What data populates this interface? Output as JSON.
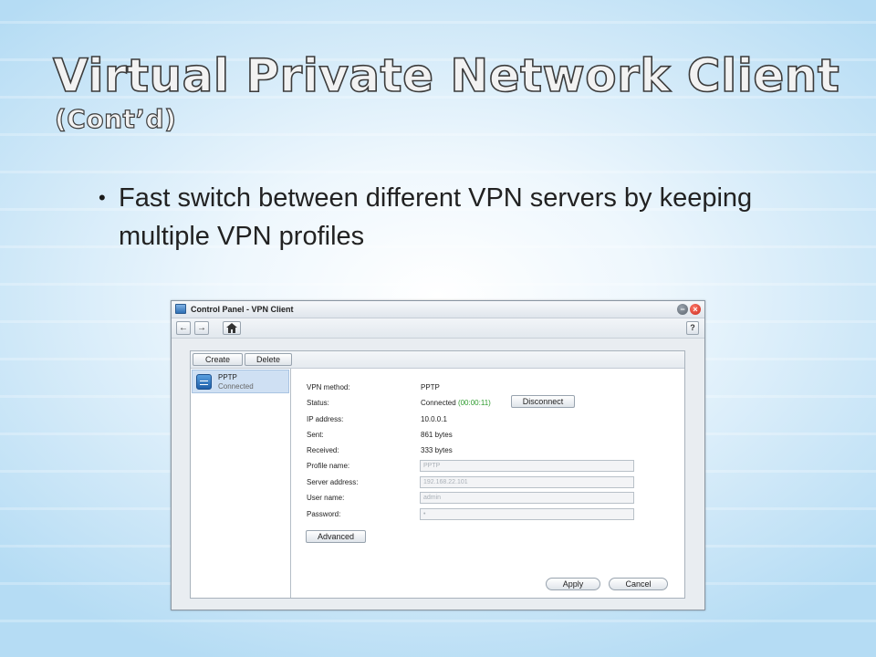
{
  "slide": {
    "title_line1": "Virtual Private Network Client",
    "title_line2": "(Cont’d)",
    "bullet": "Fast switch between different VPN servers by keeping multiple VPN profiles"
  },
  "window": {
    "title": "Control Panel - VPN Client",
    "help_label": "?"
  },
  "toolbar": {
    "create_label": "Create",
    "delete_label": "Delete"
  },
  "profiles": [
    {
      "name": "PPTP",
      "status": "Connected"
    }
  ],
  "details": {
    "vpn_method_label": "VPN method:",
    "vpn_method_value": "PPTP",
    "status_label": "Status:",
    "status_value": "Connected",
    "status_timer": "(00:00:11)",
    "disconnect_label": "Disconnect",
    "ip_label": "IP address:",
    "ip_value": "10.0.0.1",
    "sent_label": "Sent:",
    "sent_value": "861 bytes",
    "received_label": "Received:",
    "received_value": "333 bytes",
    "profile_name_label": "Profile name:",
    "profile_name_value": "PPTP",
    "server_label": "Server address:",
    "server_value": "192.168.22.101",
    "user_label": "User name:",
    "user_value": "admin",
    "password_label": "Password:",
    "password_value": "•",
    "advanced_label": "Advanced",
    "apply_label": "Apply",
    "cancel_label": "Cancel"
  }
}
